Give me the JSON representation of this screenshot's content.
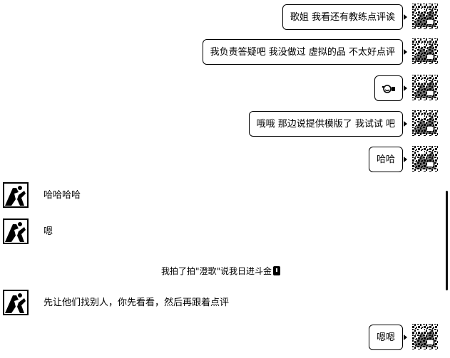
{
  "messages": [
    {
      "side": "right",
      "text": "歌姐  我看还有教练点评诶"
    },
    {
      "side": "right",
      "text": "我负责答疑吧  我没做过 虚拟的品 不太好点评"
    },
    {
      "side": "right",
      "text": ""
    },
    {
      "side": "right",
      "text": "哦哦 那边说提供模版了 我试试 吧"
    },
    {
      "side": "right",
      "text": "哈哈"
    },
    {
      "side": "left",
      "text": "哈哈哈哈"
    },
    {
      "side": "left",
      "text": "嗯"
    },
    {
      "side": "left",
      "text": "先让他们找别人，你先看看，然后再跟着点评"
    },
    {
      "side": "right",
      "text": "嗯嗯"
    }
  ],
  "system_message": "我拍了拍\"澄歌\"说我日进斗金",
  "icons": {
    "outgoing_avatar": "speckled-avatar-icon",
    "incoming_avatar": "figure-avatar-icon",
    "sticker": "emoji-sticker-icon",
    "system_icon": "phone-icon"
  }
}
